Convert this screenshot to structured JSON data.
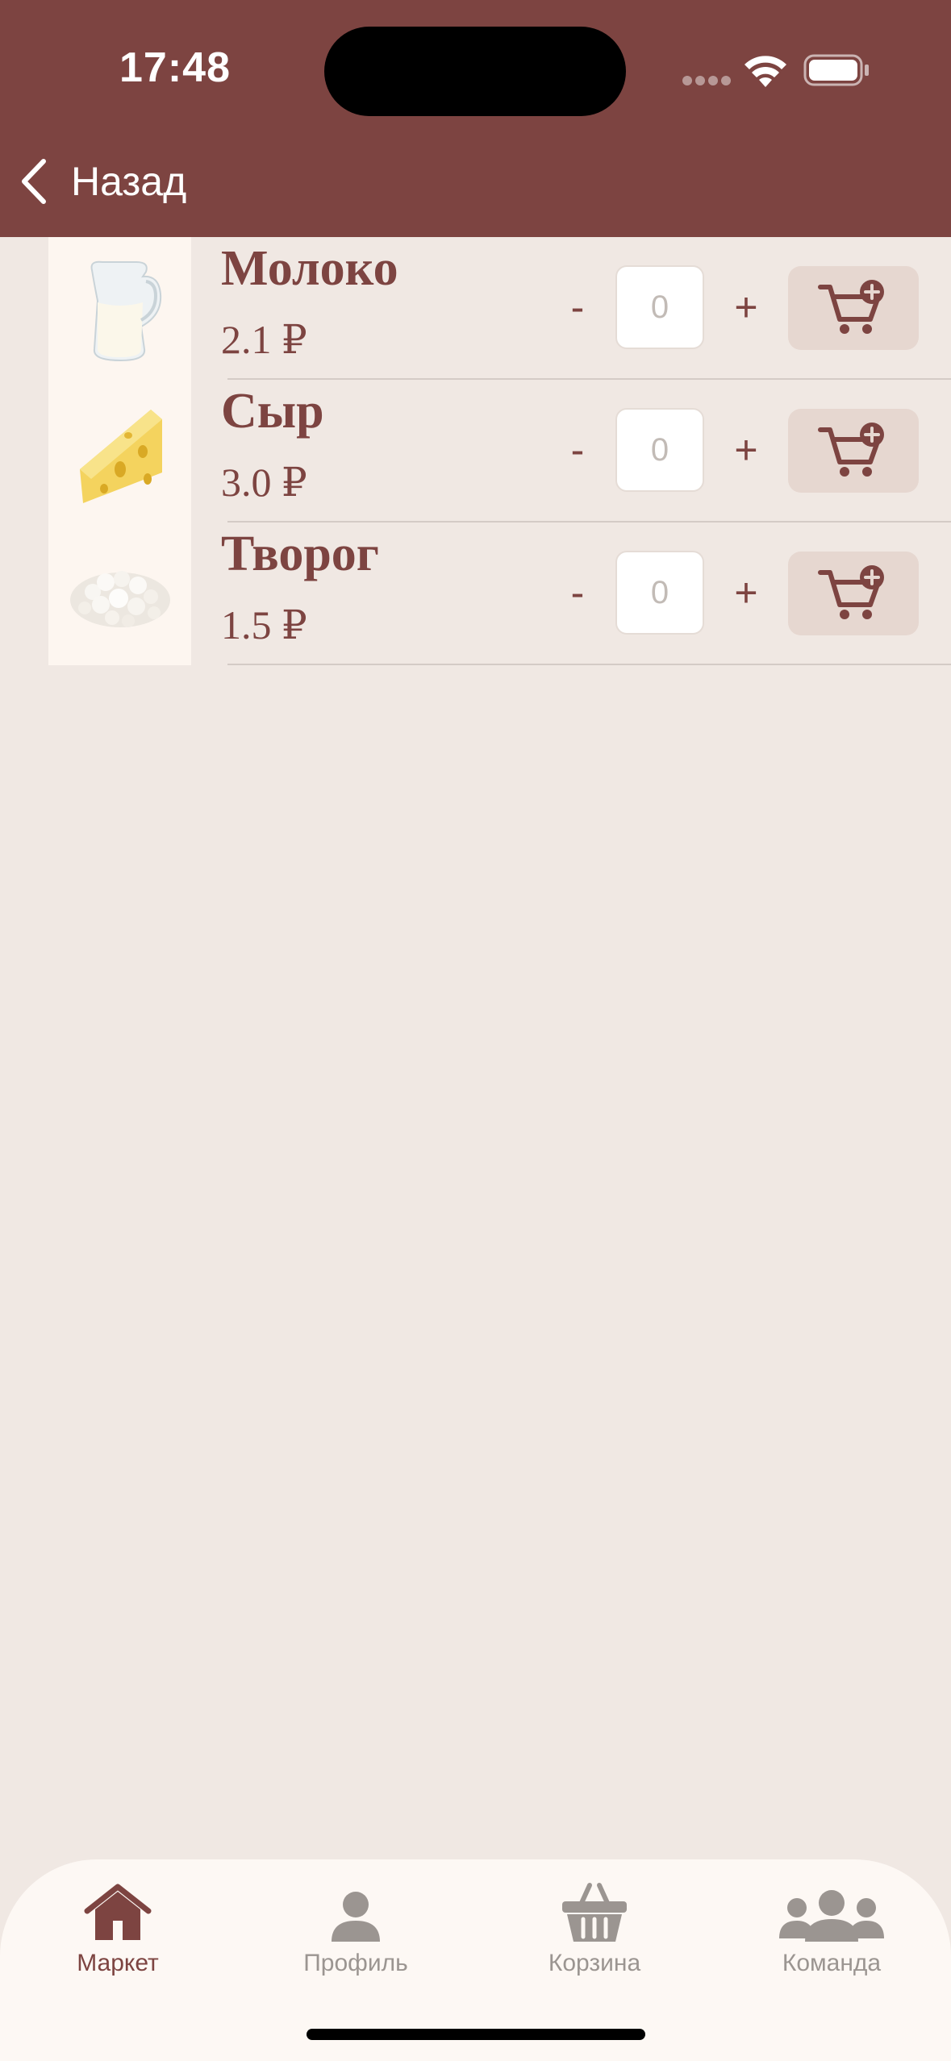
{
  "status_bar": {
    "time": "17:48"
  },
  "nav": {
    "back_label": "Назад"
  },
  "products": [
    {
      "name": "Молоко",
      "price": "2.1 ₽",
      "quantity_placeholder": "0",
      "minus": "-",
      "plus": "+",
      "image_icon": "milk-jug-icon"
    },
    {
      "name": "Сыр",
      "price": "3.0 ₽",
      "quantity_placeholder": "0",
      "minus": "-",
      "plus": "+",
      "image_icon": "cheese-icon"
    },
    {
      "name": "Творог",
      "price": "1.5 ₽",
      "quantity_placeholder": "0",
      "minus": "-",
      "plus": "+",
      "image_icon": "cottage-cheese-icon"
    }
  ],
  "tabbar": {
    "tabs": [
      {
        "label": "Маркет",
        "icon": "house-icon",
        "active": true
      },
      {
        "label": "Профиль",
        "icon": "person-icon",
        "active": false
      },
      {
        "label": "Корзина",
        "icon": "basket-icon",
        "active": false
      },
      {
        "label": "Команда",
        "icon": "group-icon",
        "active": false
      }
    ]
  },
  "colors": {
    "brand": "#7d4441",
    "background": "#f0e8e3",
    "tabbar_bg": "#fdf8f4",
    "cart_button_bg": "#e6d7d0",
    "inactive_tab": "#9b9591"
  }
}
